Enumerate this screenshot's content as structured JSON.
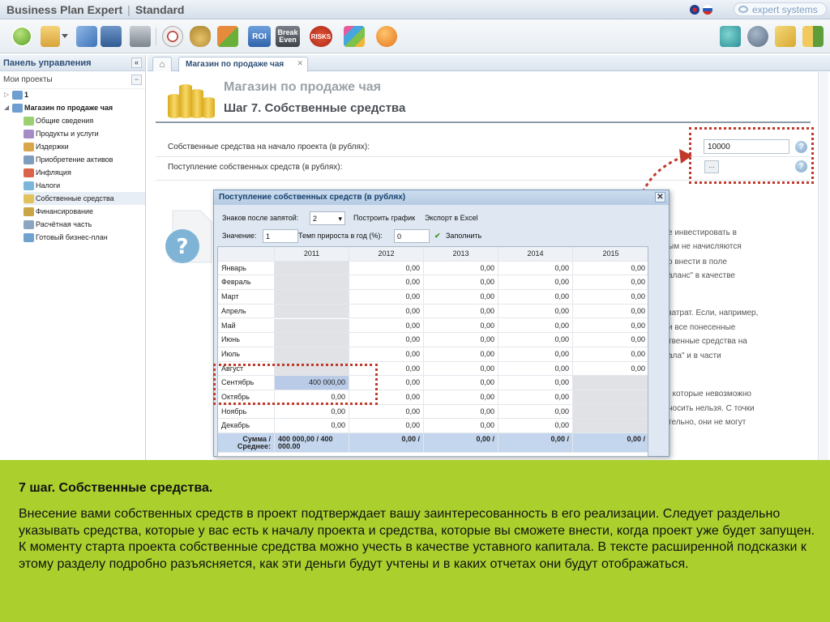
{
  "titlebar": {
    "app_name": "Business Plan Expert",
    "edition": "Standard",
    "brand": "expert systems"
  },
  "toolbar": {
    "roi": "ROI",
    "break_even": "Break Even",
    "risks": "RISKS"
  },
  "left_panel": {
    "header": "Панель управления",
    "collapse": "«",
    "my_projects": "Мои проекты",
    "minus": "−",
    "tree": {
      "root": "1",
      "project": "Магазин по продаже чая",
      "items": [
        "Общие сведения",
        "Продукты и услуги",
        "Издержки",
        "Приобретение активов",
        "Инфляция",
        "Налоги",
        "Собственные средства",
        "Финансирование",
        "Расчётная часть",
        "Готовый бизнес-план"
      ]
    }
  },
  "tabs": {
    "home": "⌂",
    "main": "Магазин по продаже чая",
    "close": "✕"
  },
  "main": {
    "project_title": "Магазин по продаже чая",
    "step_title": "Шаг 7. Собственные средства",
    "field1_label": "Собственные средства на начало проекта (в рублях):",
    "field1_value": "10000",
    "field2_label": "Поступление собственных средств (в рублях):",
    "dots": "...",
    "help": "?",
    "bg_lines": [
      "е инвестировать в",
      "ым не начисляются",
      "о внести в поле",
      "аланс\" в качестве",
      "затрат. Если, например,",
      "и все понесенные",
      "твенные средства на",
      "ала\" и в части",
      ", которые невозможно",
      "носить нельзя. С точки",
      "тельно, они не могут"
    ]
  },
  "dialog": {
    "title": "Поступление собственных средств (в рублях)",
    "close": "✕",
    "decimals_label": "Знаков после запятой:",
    "decimals_value": "2",
    "build_chart": "Построить график",
    "export_excel": "Экспорт в Excel",
    "value_label": "Значение:",
    "value_input": "1",
    "growth_label": "Темп прироста в год (%):",
    "growth_input": "0",
    "fill_label": "Заполнить",
    "years": [
      "2011",
      "2012",
      "2013",
      "2014",
      "2015"
    ],
    "months": [
      "Январь",
      "Февраль",
      "Март",
      "Апрель",
      "Май",
      "Июнь",
      "Июль",
      "Август",
      "Сентябрь",
      "Октябрь",
      "Ноябрь",
      "Декабрь"
    ],
    "cells": [
      [
        "",
        "0,00",
        "0,00",
        "0,00",
        "0,00"
      ],
      [
        "",
        "0,00",
        "0,00",
        "0,00",
        "0,00"
      ],
      [
        "",
        "0,00",
        "0,00",
        "0,00",
        "0,00"
      ],
      [
        "",
        "0,00",
        "0,00",
        "0,00",
        "0,00"
      ],
      [
        "",
        "0,00",
        "0,00",
        "0,00",
        "0,00"
      ],
      [
        "",
        "0,00",
        "0,00",
        "0,00",
        "0,00"
      ],
      [
        "",
        "0,00",
        "0,00",
        "0,00",
        "0,00"
      ],
      [
        "",
        "0,00",
        "0,00",
        "0,00",
        "0,00"
      ],
      [
        "400 000,00",
        "0,00",
        "0,00",
        "0,00",
        ""
      ],
      [
        "0,00",
        "0,00",
        "0,00",
        "0,00",
        ""
      ],
      [
        "0,00",
        "0,00",
        "0,00",
        "0,00",
        ""
      ],
      [
        "0,00",
        "0,00",
        "0,00",
        "0,00",
        ""
      ]
    ],
    "sum_label_1": "Сумма /",
    "sum_label_2": "Среднее:",
    "sums": [
      "400 000,00 / 400 000.00",
      "0,00 /",
      "0,00 /",
      "0,00 /",
      "0,00 /"
    ]
  },
  "caption": {
    "title": "7 шаг. Собственные средства.",
    "text": "Внесение вами собственных средств в проект подтверждает вашу заинтересованность в его реализации. Следует раздельно указывать средства, которые у вас есть к началу проекта и средства, которые вы сможете внести, когда проект уже будет запущен.  К моменту старта проекта собственные средства можно учесть в качестве уставного капитала.  В тексте расширенной подсказки к этому разделу подробно разъясняется, как эти деньги будут учтены и в каких  отчетах они будут отображаться."
  }
}
